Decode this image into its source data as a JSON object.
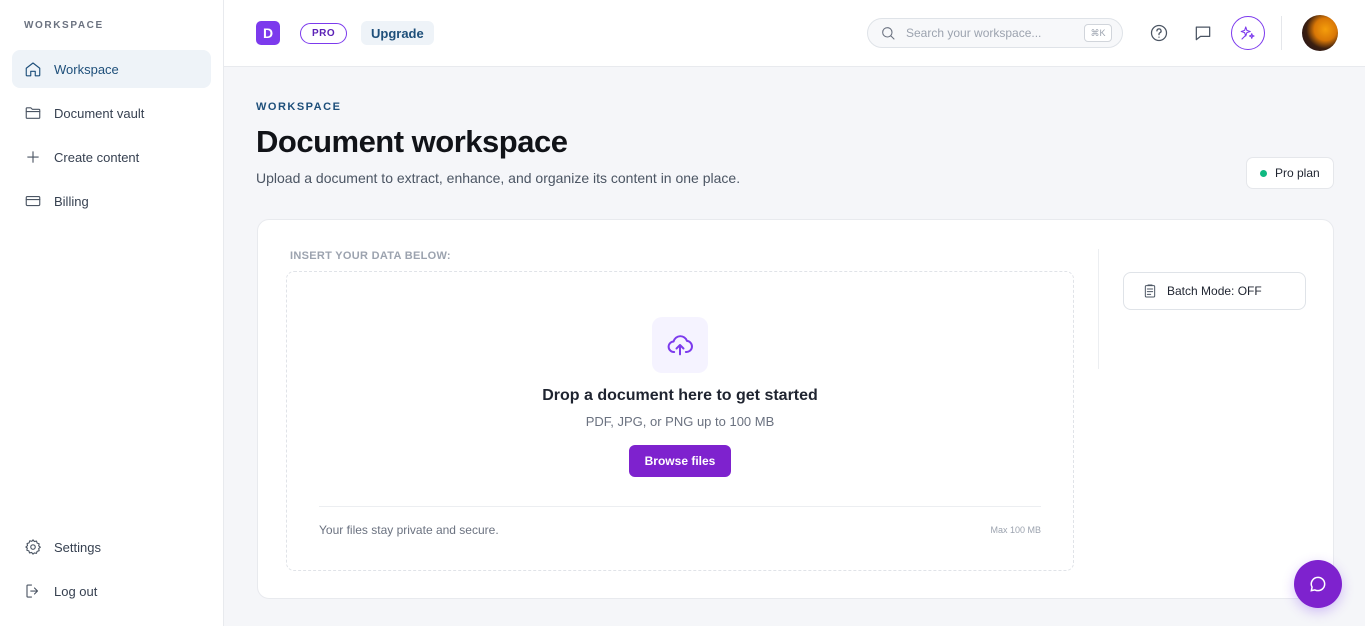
{
  "sidebar": {
    "section_label": "WORKSPACE",
    "items": [
      {
        "label": "Workspace",
        "icon": "home-icon"
      },
      {
        "label": "Document vault",
        "icon": "folder-icon"
      },
      {
        "label": "Create content",
        "icon": "plus-icon"
      },
      {
        "label": "Billing",
        "icon": "credit-card-icon"
      }
    ],
    "bottom_items": [
      {
        "label": "Settings",
        "icon": "gear-icon"
      },
      {
        "label": "Log out",
        "icon": "logout-icon"
      }
    ]
  },
  "header": {
    "logo_letter": "D",
    "pro_badge": "PRO",
    "upgrade_label": "Upgrade",
    "search": {
      "placeholder": "Search your workspace...",
      "shortcut": "⌘K"
    }
  },
  "main": {
    "eyebrow": "WORKSPACE",
    "title": "Document workspace",
    "subtitle": "Upload a document to extract, enhance, and organize its content in one place.",
    "plan_badge": "Pro plan",
    "plan_status_color": "#10b981",
    "card": {
      "insert_label": "INSERT YOUR DATA BELOW:",
      "drop_title": "Drop a document here to get started",
      "drop_sub": "PDF, JPG, or PNG up to 100 MB",
      "browse_label": "Browse files",
      "privacy_note": "Your files stay private and secure.",
      "max_note": "Max 100 MB",
      "batch_label": "Batch Mode: OFF"
    }
  },
  "colors": {
    "accent": "#7e22ce",
    "nav_active": "#1e4f7a"
  }
}
